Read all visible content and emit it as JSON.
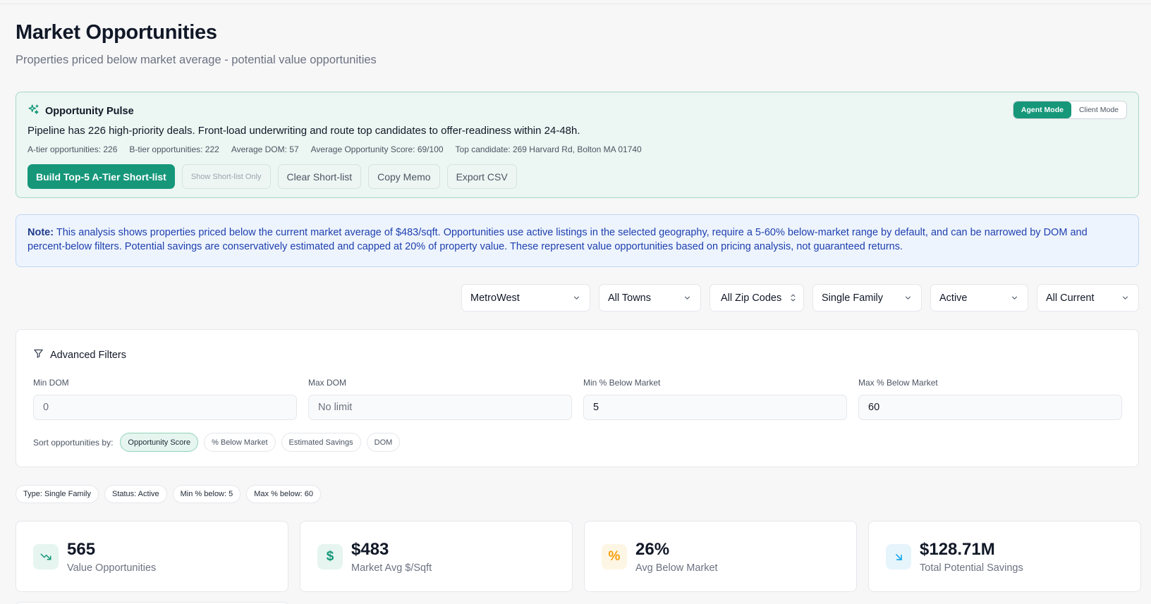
{
  "header": {
    "title": "Market Opportunities",
    "subtitle": "Properties priced below market average - potential value opportunities"
  },
  "pulse": {
    "title": "Opportunity Pulse",
    "icon": "sparkles-icon",
    "modes": [
      "Agent Mode",
      "Client Mode"
    ],
    "active_mode": "Agent Mode",
    "summary": "Pipeline has 226 high-priority deals. Front-load underwriting and route top candidates to offer-readiness within 24-48h.",
    "stats": [
      "A-tier opportunities: 226",
      "B-tier opportunities: 222",
      "Average DOM: 57",
      "Average Opportunity Score: 69/100",
      "Top candidate: 269 Harvard Rd, Bolton MA 01740"
    ],
    "actions": {
      "build": "Build Top-5 A-Tier Short-list",
      "show_only": "Show Short-list Only",
      "clear": "Clear Short-list",
      "copy": "Copy Memo",
      "export": "Export CSV"
    }
  },
  "note": {
    "label": "Note:",
    "text": "This analysis shows properties priced below the current market average of $483/sqft. Opportunities use active listings in the selected geography, require a 5-60% below-market range by default, and can be narrowed by DOM and percent-below filters. Potential savings are conservatively estimated and capped at 20% of property value. These represent value opportunities based on pricing analysis, not guaranteed returns."
  },
  "selects": {
    "region": "MetroWest",
    "town": "All Towns",
    "zip": "All Zip Codes",
    "type": "Single Family",
    "status": "Active",
    "period": "All Current"
  },
  "advanced": {
    "title": "Advanced Filters",
    "min_dom": {
      "label": "Min DOM",
      "placeholder": "0",
      "value": ""
    },
    "max_dom": {
      "label": "Max DOM",
      "placeholder": "No limit",
      "value": ""
    },
    "min_below": {
      "label": "Min % Below Market",
      "placeholder": "",
      "value": "5"
    },
    "max_below": {
      "label": "Max % Below Market",
      "placeholder": "",
      "value": "60"
    },
    "sort_label": "Sort opportunities by:",
    "sort_options": [
      "Opportunity Score",
      "% Below Market",
      "Estimated Savings",
      "DOM"
    ],
    "active_sort": "Opportunity Score"
  },
  "tags": [
    "Type: Single Family",
    "Status: Active",
    "Min % below: 5",
    "Max % below: 60"
  ],
  "stats": [
    {
      "value": "565",
      "label": "Value Opportunities",
      "icon": "trending-down-icon",
      "color": "#16977a",
      "bg": "#e6f5ef"
    },
    {
      "value": "$483",
      "label": "Market Avg $/Sqft",
      "icon": "dollar-icon",
      "color": "#16977a",
      "bg": "#e6f5ef"
    },
    {
      "value": "26%",
      "label": "Avg Below Market",
      "icon": "percent-icon",
      "color": "#f59e0b",
      "bg": "#fef6e4"
    },
    {
      "value": "$128.71M",
      "label": "Total Potential Savings",
      "icon": "arrow-down-right-icon",
      "color": "#0ea5e9",
      "bg": "#e6f4fb"
    }
  ],
  "colors": {
    "accent": "#16977a",
    "note_text": "#1e40af",
    "pulse_bg": "#ecf6f2"
  }
}
